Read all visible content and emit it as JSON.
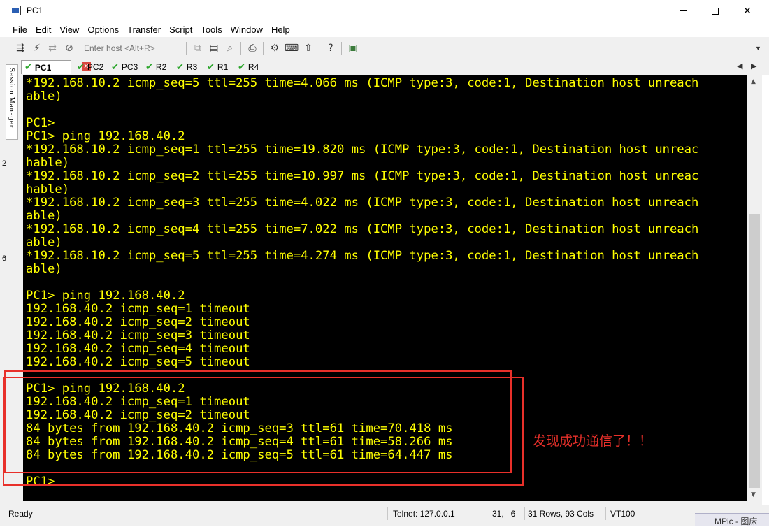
{
  "window": {
    "title": "PC1"
  },
  "menu": [
    "File",
    "Edit",
    "View",
    "Options",
    "Transfer",
    "Script",
    "Tools",
    "Window",
    "Help"
  ],
  "menu_underline": [
    "F",
    "E",
    "V",
    "O",
    "T",
    "S",
    "l",
    "W",
    "H"
  ],
  "toolbar": {
    "host_placeholder": "Enter host <Alt+R>"
  },
  "session_manager_label": "Session Manager",
  "tabs": [
    {
      "label": "PC1",
      "active": true
    },
    {
      "label": "PC2"
    },
    {
      "label": "PC3"
    },
    {
      "label": "R2"
    },
    {
      "label": "R3"
    },
    {
      "label": "R1"
    },
    {
      "label": "R4"
    }
  ],
  "terminal_lines": [
    "*192.168.10.2 icmp_seq=5 ttl=255 time=4.066 ms (ICMP type:3, code:1, Destination host unreach",
    "able)",
    "",
    "PC1>",
    "PC1> ping 192.168.40.2",
    "*192.168.10.2 icmp_seq=1 ttl=255 time=19.820 ms (ICMP type:3, code:1, Destination host unreac",
    "hable)",
    "*192.168.10.2 icmp_seq=2 ttl=255 time=10.997 ms (ICMP type:3, code:1, Destination host unreac",
    "hable)",
    "*192.168.10.2 icmp_seq=3 ttl=255 time=4.022 ms (ICMP type:3, code:1, Destination host unreach",
    "able)",
    "*192.168.10.2 icmp_seq=4 ttl=255 time=7.022 ms (ICMP type:3, code:1, Destination host unreach",
    "able)",
    "*192.168.10.2 icmp_seq=5 ttl=255 time=4.274 ms (ICMP type:3, code:1, Destination host unreach",
    "able)",
    "",
    "PC1> ping 192.168.40.2",
    "192.168.40.2 icmp_seq=1 timeout",
    "192.168.40.2 icmp_seq=2 timeout",
    "192.168.40.2 icmp_seq=3 timeout",
    "192.168.40.2 icmp_seq=4 timeout",
    "192.168.40.2 icmp_seq=5 timeout",
    "",
    "PC1> ping 192.168.40.2",
    "192.168.40.2 icmp_seq=1 timeout",
    "192.168.40.2 icmp_seq=2 timeout",
    "84 bytes from 192.168.40.2 icmp_seq=3 ttl=61 time=70.418 ms",
    "84 bytes from 192.168.40.2 icmp_seq=4 ttl=61 time=58.266 ms",
    "84 bytes from 192.168.40.2 icmp_seq=5 ttl=61 time=64.447 ms",
    "",
    "PC1>"
  ],
  "annotation": "发现成功通信了！！",
  "status": {
    "ready": "Ready",
    "connection": "Telnet: 127.0.0.1",
    "cursor": "31,   6",
    "size": "31 Rows, 93 Cols",
    "emulation": "VT100"
  },
  "left_edge_digits": [
    "2",
    "6"
  ],
  "taskbar_peek": "MPic - 图床",
  "colors": {
    "terminal_bg": "#000000",
    "terminal_fg": "#ffff00",
    "annotation": "#e8302a",
    "tab_check": "#2aa52a"
  }
}
